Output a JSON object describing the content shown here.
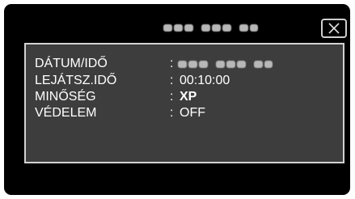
{
  "header": {
    "title_redacted": "blurred",
    "close_label": "close"
  },
  "info": {
    "rows": [
      {
        "label": "DÁTUM/IDŐ",
        "colon": ":",
        "value": "",
        "value_redacted": true
      },
      {
        "label": "LEJÁTSZ.IDŐ",
        "colon": ":",
        "value": "00:10:00"
      },
      {
        "label": "MINŐSÉG",
        "colon": ":",
        "value": "XP"
      },
      {
        "label": "VÉDELEM",
        "colon": ":",
        "value": "OFF"
      }
    ]
  },
  "colors": {
    "background": "#000000",
    "panel": "#3d3d3d",
    "panel_border": "#d2d2d2",
    "text": "#ffffff",
    "redaction": "#b8b8b8"
  },
  "icons": {
    "close": "close-icon"
  }
}
